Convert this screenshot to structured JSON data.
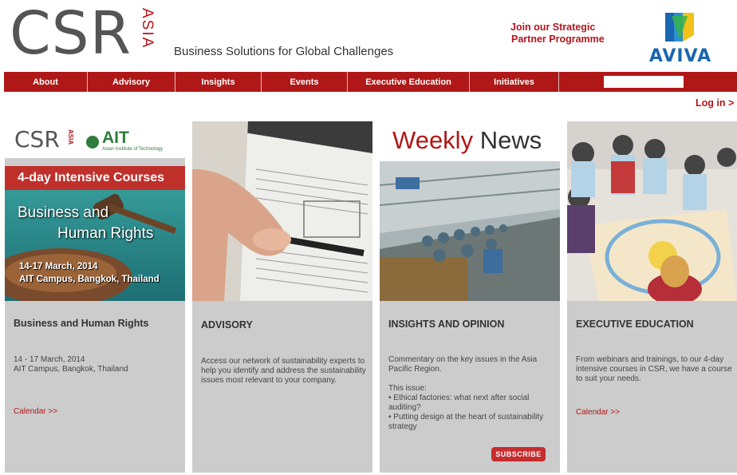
{
  "header": {
    "logo_main": "CSR",
    "logo_sub": "ASIA",
    "tagline": "Business Solutions for Global Challenges",
    "partner_line1": "Join our Strategic",
    "partner_line2": "Partner Programme",
    "sponsor": "AVIVA"
  },
  "nav": {
    "items": [
      {
        "label": "About"
      },
      {
        "label": "Advisory"
      },
      {
        "label": "Insights"
      },
      {
        "label": "Events"
      },
      {
        "label": "Executive Education"
      },
      {
        "label": "Initiatives"
      }
    ],
    "search_placeholder": ""
  },
  "login": "Log in >",
  "cards": [
    {
      "promo": {
        "logo": "CSR",
        "logo_sub": "ASIA",
        "partner": "AIT",
        "partner_full": "Asian Institute of Technology",
        "banner": "4-day Intensive Courses",
        "headline1": "Business and",
        "headline2": "Human Rights",
        "date": "14-17 March, 2014",
        "place": "AIT Campus, Bangkok, Thailand"
      },
      "title": "Business and Human Rights",
      "body1": "14 - 17 March, 2014",
      "body2": "AIT Campus, Bangkok, Thailand",
      "link": "Calendar >>"
    },
    {
      "title": "ADVISORY",
      "body": "Access our network of sustainability experts to help you identify and address the sustainability issues most relevant to your company."
    },
    {
      "heading_word1": "Weekly",
      "heading_word2": "News",
      "title": "INSIGHTS AND OPINION",
      "body": "Commentary on the key issues in the Asia Pacific Region.",
      "issue_label": "This issue:",
      "bullet1": "• Ethical factories: what next after social auditing?",
      "bullet2": "• Putting design at the heart of sustainability strategy",
      "subscribe": "SUBSCRIBE"
    },
    {
      "title": "EXECUTIVE EDUCATION",
      "body": "From webinars and trainings, to our 4-day intensive courses in CSR, we have a course to suit your needs.",
      "link": "Calendar >>"
    }
  ],
  "colors": {
    "brand_red": "#b01818",
    "card_grey": "#cccccc",
    "aviva_blue": "#1a66b0"
  }
}
